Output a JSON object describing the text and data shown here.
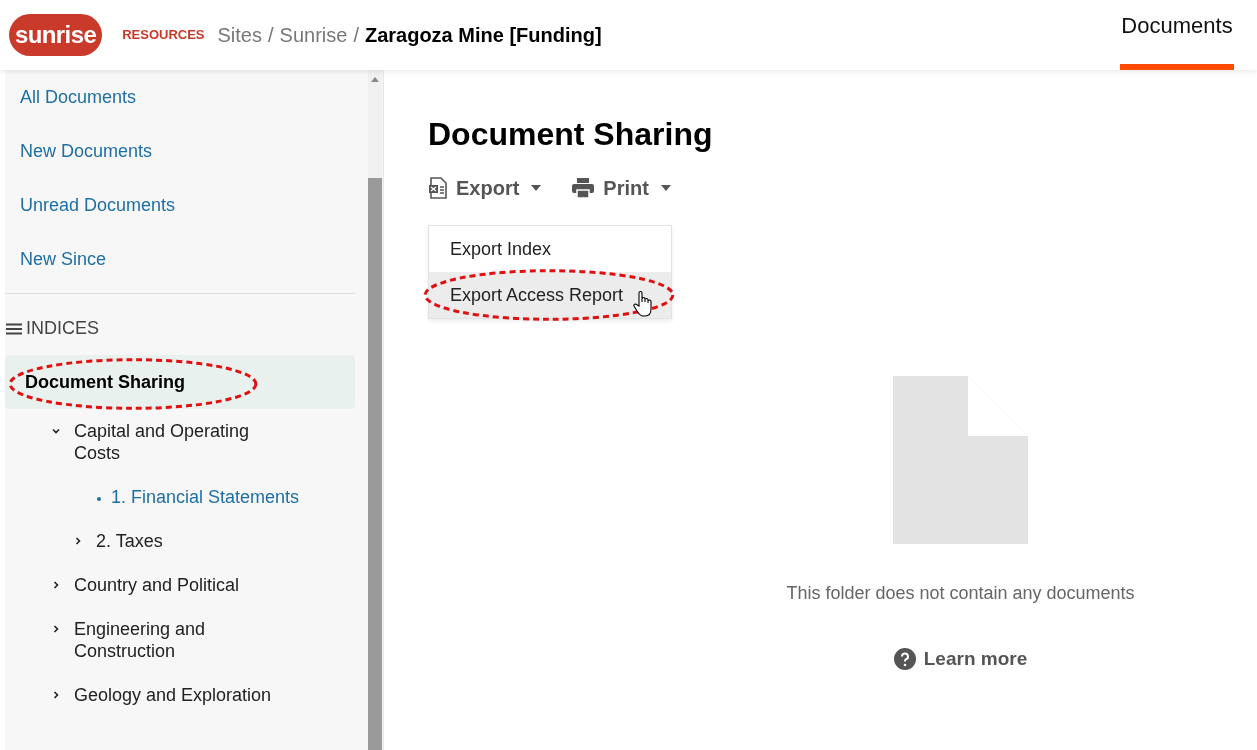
{
  "header": {
    "logo_word": "sunrise",
    "logo_sub": "RESOURCES",
    "breadcrumb": [
      {
        "label": "Sites",
        "current": false
      },
      {
        "label": "Sunrise",
        "current": false
      },
      {
        "label": "Zaragoza Mine [Funding]",
        "current": true
      }
    ],
    "separator": "/",
    "tabs": [
      {
        "label": "Documents",
        "selected": true
      }
    ]
  },
  "sidebar": {
    "links": [
      "All Documents",
      "New Documents",
      "Unread Documents",
      "New Since"
    ],
    "section_title": "INDICES",
    "tree": [
      {
        "label": "Document Sharing",
        "kind": "root",
        "selected": true,
        "children": [
          {
            "label": "Capital and Operating Costs",
            "kind": "folder",
            "expanded": true,
            "children": [
              {
                "label": "1. Financial Statements",
                "kind": "leaf"
              },
              {
                "label": "2. Taxes",
                "kind": "folder",
                "expanded": false
              }
            ]
          },
          {
            "label": "Country and Political",
            "kind": "folder",
            "expanded": false
          },
          {
            "label": "Engineering and Construction",
            "kind": "folder",
            "expanded": false
          },
          {
            "label": "Geology and Exploration",
            "kind": "folder",
            "expanded": false
          }
        ]
      }
    ]
  },
  "main": {
    "title": "Document Sharing",
    "toolbar": [
      {
        "label": "Export",
        "kind": "excel"
      },
      {
        "label": "Print",
        "kind": "print"
      }
    ],
    "menu_open": true,
    "menu": [
      {
        "label": "Export Index",
        "selected": false
      },
      {
        "label": "Export Access Report",
        "selected": true
      }
    ],
    "empty_message": "This folder does not contain any documents",
    "help_link": "Learn more"
  }
}
